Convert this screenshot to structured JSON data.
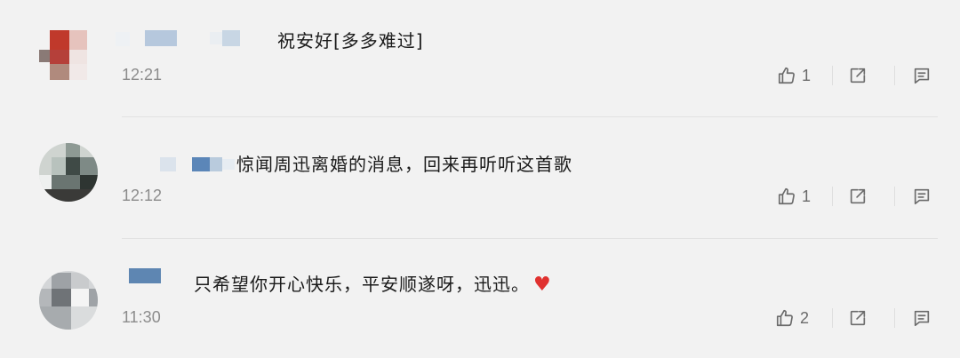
{
  "comments": [
    {
      "text": "祝安好[多多难过]",
      "time": "12:21",
      "likes": "1"
    },
    {
      "text": "惊闻周迅离婚的消息，回来再听听这首歌",
      "time": "12:12",
      "likes": "1"
    },
    {
      "text": "只希望你开心快乐，平安顺遂呀，迅迅。",
      "time": "11:30",
      "likes": "2"
    }
  ],
  "icons": {
    "like": "thumbs-up-icon",
    "share": "share-icon",
    "reply": "comment-icon",
    "heart": "red-heart-icon"
  },
  "colors": {
    "background": "#f2f2f2",
    "text": "#1a1a1a",
    "meta": "#8c8c8c",
    "heart": "#e0312f"
  }
}
